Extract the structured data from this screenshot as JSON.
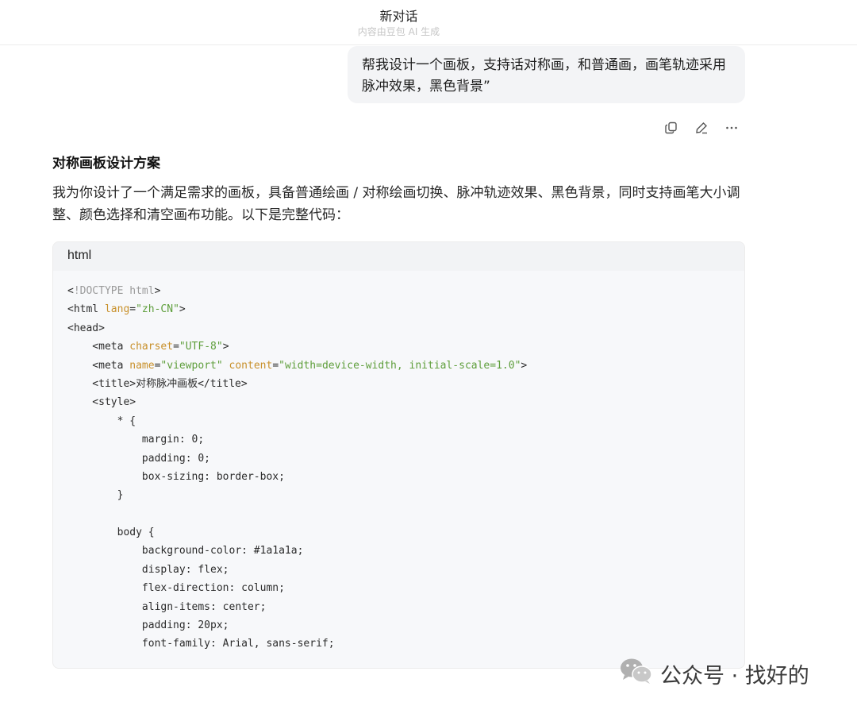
{
  "header": {
    "title": "新对话",
    "subtitle": "内容由豆包 AI 生成"
  },
  "user_message": {
    "text": "帮我设计一个画板，支持话对称画，和普通画，画笔轨迹采用脉冲效果，黑色背景”"
  },
  "actions": [
    {
      "icon": "copy-icon"
    },
    {
      "icon": "edit-icon"
    },
    {
      "icon": "more-icon"
    }
  ],
  "answer": {
    "title": "对称画板设计方案",
    "intro": "我为你设计了一个满足需求的画板，具备普通绘画 / 对称绘画切换、脉冲轨迹效果、黑色背景，同时支持画笔大小调整、颜色选择和清空画布功能。以下是完整代码："
  },
  "code": {
    "language": "html",
    "lines": [
      [
        [
          "t",
          "<"
        ],
        [
          "dim",
          "!DOCTYPE html"
        ],
        [
          "t",
          ">"
        ]
      ],
      [
        [
          "t",
          "<html "
        ],
        [
          "attr",
          "lang"
        ],
        [
          "t",
          "="
        ],
        [
          "str",
          "\"zh-CN\""
        ],
        [
          "t",
          ">"
        ]
      ],
      [
        [
          "t",
          "<head>"
        ]
      ],
      [
        [
          "t",
          "    <meta "
        ],
        [
          "attr",
          "charset"
        ],
        [
          "t",
          "="
        ],
        [
          "str",
          "\"UTF-8\""
        ],
        [
          "t",
          ">"
        ]
      ],
      [
        [
          "t",
          "    <meta "
        ],
        [
          "attr",
          "name"
        ],
        [
          "t",
          "="
        ],
        [
          "str",
          "\"viewport\""
        ],
        [
          "t",
          " "
        ],
        [
          "attr",
          "content"
        ],
        [
          "t",
          "="
        ],
        [
          "str",
          "\"width=device-width, initial-scale=1.0\""
        ],
        [
          "t",
          ">"
        ]
      ],
      [
        [
          "t",
          "    <title>对称脉冲画板</title>"
        ]
      ],
      [
        [
          "t",
          "    <style>"
        ]
      ],
      [
        [
          "t",
          "        * {"
        ]
      ],
      [
        [
          "t",
          "            margin: 0;"
        ]
      ],
      [
        [
          "t",
          "            padding: 0;"
        ]
      ],
      [
        [
          "t",
          "            box-sizing: border-box;"
        ]
      ],
      [
        [
          "t",
          "        }"
        ]
      ],
      [
        [
          "t",
          ""
        ]
      ],
      [
        [
          "t",
          "        body {"
        ]
      ],
      [
        [
          "t",
          "            background-color: #1a1a1a;"
        ]
      ],
      [
        [
          "t",
          "            display: flex;"
        ]
      ],
      [
        [
          "t",
          "            flex-direction: column;"
        ]
      ],
      [
        [
          "t",
          "            align-items: center;"
        ]
      ],
      [
        [
          "t",
          "            padding: 20px;"
        ]
      ],
      [
        [
          "t",
          "            font-family: Arial, sans-serif;"
        ]
      ]
    ]
  },
  "watermark": {
    "text": "公众号 · 找好的",
    "icon": "wechat-icon"
  }
}
